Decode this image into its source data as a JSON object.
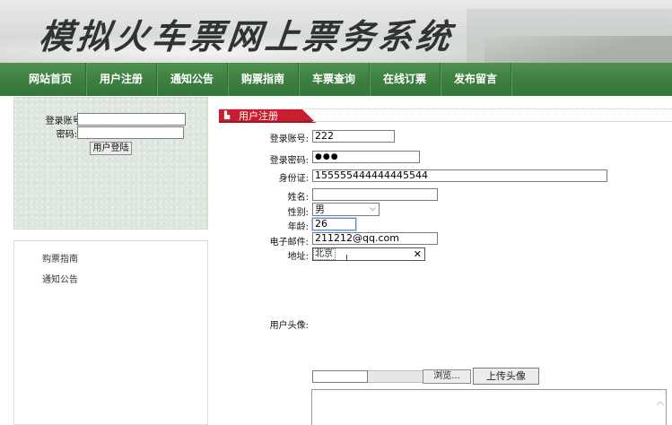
{
  "header": {
    "site_title": "模拟火车票网上票务系统"
  },
  "nav": {
    "items": [
      "网站首页",
      "用户注册",
      "通知公告",
      "购票指南",
      "车票查询",
      "在线订票",
      "发布留言"
    ]
  },
  "login": {
    "account_label": "登录账号:",
    "password_label": "密码:",
    "account_value": "",
    "password_value": "",
    "login_button": "用户登陆"
  },
  "sidebar": {
    "links": [
      "购票指南",
      "通知公告"
    ]
  },
  "form": {
    "title": "用户注册",
    "fields": {
      "username": {
        "label": "登录账号:",
        "value": "222"
      },
      "password": {
        "label": "登录密码:",
        "value": "●●●"
      },
      "id_card": {
        "label": "身份证:",
        "value": "155555444444445544"
      },
      "name": {
        "label": "姓名:",
        "value": ""
      },
      "gender": {
        "label": "性别:",
        "value": "男"
      },
      "age": {
        "label": "年龄:",
        "value": "26"
      },
      "email": {
        "label": "电子邮件:",
        "value": "211212@qq.com"
      },
      "address": {
        "label": "地址:",
        "value": "北京"
      },
      "avatar": {
        "label": "用户头像:"
      }
    },
    "browse_button": "浏览...",
    "upload_button": "上传头像"
  },
  "icons": {
    "gender_dropdown": "chevron-down-icon",
    "address_clear": "close-icon",
    "cursor": "text-cursor-icon",
    "scroll": "chevron-up-icon"
  },
  "colors": {
    "nav_green": "#3e7f42",
    "header_red": "#c81e2f"
  }
}
